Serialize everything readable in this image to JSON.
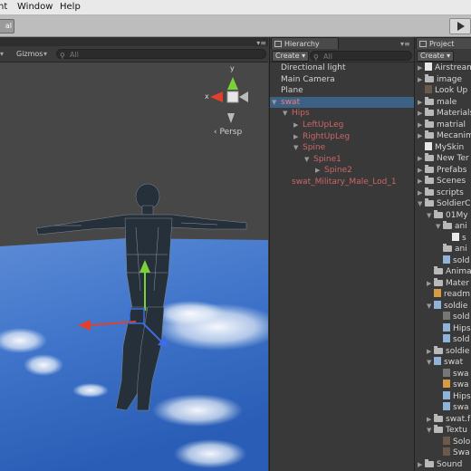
{
  "menubar": {
    "items": [
      "nt",
      "Window",
      "Help"
    ]
  },
  "toolbar": {
    "left_button": "al"
  },
  "scene": {
    "gizmos_label": "Gizmos",
    "search_placeholder": "All",
    "persp_label": "‹ Persp",
    "gizmo_axes": {
      "x": "x",
      "y": "y"
    }
  },
  "hierarchy": {
    "tab_label": "Hierarchy",
    "create_label": "Create",
    "search_placeholder": "All",
    "items": [
      {
        "label": "Directional light",
        "depth": 0,
        "arrow": "",
        "color": "#d4d4d4"
      },
      {
        "label": "Main Camera",
        "depth": 0,
        "arrow": "",
        "color": "#d4d4d4"
      },
      {
        "label": "Plane",
        "depth": 0,
        "arrow": "",
        "color": "#d4d4d4"
      },
      {
        "label": "swat",
        "depth": 0,
        "arrow": "▼",
        "color": "#ef7d7d",
        "selected": true
      },
      {
        "label": "Hips",
        "depth": 1,
        "arrow": "▼",
        "color": "#cc6666"
      },
      {
        "label": "LeftUpLeg",
        "depth": 2,
        "arrow": "▶",
        "color": "#cc6666"
      },
      {
        "label": "RightUpLeg",
        "depth": 2,
        "arrow": "▶",
        "color": "#cc6666"
      },
      {
        "label": "Spine",
        "depth": 2,
        "arrow": "▼",
        "color": "#cc6666"
      },
      {
        "label": "Spine1",
        "depth": 3,
        "arrow": "▼",
        "color": "#cc6666"
      },
      {
        "label": "Spine2",
        "depth": 4,
        "arrow": "▶",
        "color": "#cc6666"
      },
      {
        "label": "swat_Military_Male_Lod_1",
        "depth": 1,
        "arrow": "",
        "color": "#cc6666"
      }
    ]
  },
  "project": {
    "tab_label": "Project",
    "create_label": "Create",
    "items": [
      {
        "label": "Airstream",
        "depth": 0,
        "arrow": "▶",
        "icon": "text-asset"
      },
      {
        "label": "image",
        "depth": 0,
        "arrow": "▶",
        "icon": "folder"
      },
      {
        "label": "Look Up",
        "depth": 0,
        "arrow": "",
        "icon": "dark-asset"
      },
      {
        "label": "male",
        "depth": 0,
        "arrow": "▶",
        "icon": "folder"
      },
      {
        "label": "Materials",
        "depth": 0,
        "arrow": "▶",
        "icon": "folder"
      },
      {
        "label": "matrial",
        "depth": 0,
        "arrow": "▶",
        "icon": "folder"
      },
      {
        "label": "Mecanim",
        "depth": 0,
        "arrow": "▶",
        "icon": "folder"
      },
      {
        "label": "MySkin",
        "depth": 0,
        "arrow": "",
        "icon": "white-asset"
      },
      {
        "label": "New Ter",
        "depth": 0,
        "arrow": "▶",
        "icon": "folder"
      },
      {
        "label": "Prefabs",
        "depth": 0,
        "arrow": "▶",
        "icon": "folder"
      },
      {
        "label": "Scenes",
        "depth": 0,
        "arrow": "▶",
        "icon": "folder"
      },
      {
        "label": "scripts",
        "depth": 0,
        "arrow": "▶",
        "icon": "folder"
      },
      {
        "label": "SoldierC",
        "depth": 0,
        "arrow": "▼",
        "icon": "folder"
      },
      {
        "label": "01My",
        "depth": 1,
        "arrow": "▼",
        "icon": "folder"
      },
      {
        "label": "ani",
        "depth": 2,
        "arrow": "▼",
        "icon": "folder"
      },
      {
        "label": "s",
        "depth": 3,
        "arrow": "",
        "icon": "white-asset"
      },
      {
        "label": "ani",
        "depth": 2,
        "arrow": "",
        "icon": "folder"
      },
      {
        "label": "sold",
        "depth": 2,
        "arrow": "",
        "icon": "blue-asset"
      },
      {
        "label": "Anima",
        "depth": 1,
        "arrow": "",
        "icon": "folder"
      },
      {
        "label": "Mater",
        "depth": 1,
        "arrow": "▶",
        "icon": "folder"
      },
      {
        "label": "readm",
        "depth": 1,
        "arrow": "",
        "icon": "orange-asset"
      },
      {
        "label": "soldie",
        "depth": 1,
        "arrow": "▼",
        "icon": "blue-asset"
      },
      {
        "label": "sold",
        "depth": 2,
        "arrow": "",
        "icon": "dim-asset"
      },
      {
        "label": "Hips",
        "depth": 2,
        "arrow": "",
        "icon": "blue-asset"
      },
      {
        "label": "sold",
        "depth": 2,
        "arrow": "",
        "icon": "blue-asset"
      },
      {
        "label": "soldie",
        "depth": 1,
        "arrow": "▶",
        "icon": "folder"
      },
      {
        "label": "swat",
        "depth": 1,
        "arrow": "▼",
        "icon": "blue-asset"
      },
      {
        "label": "swa",
        "depth": 2,
        "arrow": "",
        "icon": "dim-asset"
      },
      {
        "label": "swa",
        "depth": 2,
        "arrow": "",
        "icon": "orange-asset"
      },
      {
        "label": "Hips",
        "depth": 2,
        "arrow": "",
        "icon": "blue-asset"
      },
      {
        "label": "swa",
        "depth": 2,
        "arrow": "",
        "icon": "blue-asset"
      },
      {
        "label": "swat.f",
        "depth": 1,
        "arrow": "▶",
        "icon": "folder"
      },
      {
        "label": "Textu",
        "depth": 1,
        "arrow": "▼",
        "icon": "folder"
      },
      {
        "label": "Solo",
        "depth": 2,
        "arrow": "",
        "icon": "dark-asset"
      },
      {
        "label": "Swa",
        "depth": 2,
        "arrow": "",
        "icon": "dark-asset"
      },
      {
        "label": "Sound",
        "depth": 0,
        "arrow": "▶",
        "icon": "folder"
      }
    ]
  },
  "colors": {
    "selection": "#3d6185",
    "prefab_text": "#cc6666",
    "axis_x": "#e0412f",
    "axis_y": "#7ad236",
    "axis_z": "#3d6de0"
  }
}
